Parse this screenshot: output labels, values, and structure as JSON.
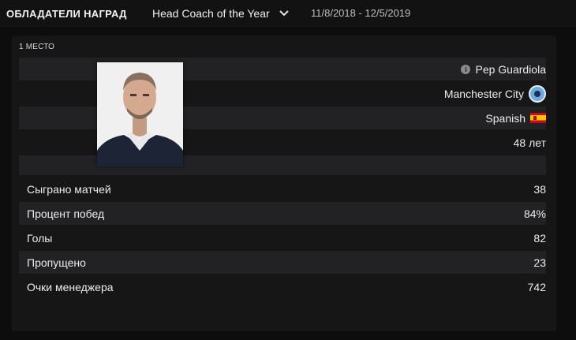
{
  "header": {
    "title": "ОБЛАДАТЕЛИ НАГРАД",
    "award_selector": "Head Coach of the Year",
    "date_range": "11/8/2018 - 12/5/2019"
  },
  "winner": {
    "place": "1 МЕСТО",
    "name": "Pep Guardiola",
    "club": "Manchester City",
    "nationality": "Spanish",
    "age": "48 лет"
  },
  "stats": [
    {
      "label": "Сыграно матчей",
      "value": "38"
    },
    {
      "label": "Процент побед",
      "value": "84%"
    },
    {
      "label": "Голы",
      "value": "82"
    },
    {
      "label": "Пропущено",
      "value": "23"
    },
    {
      "label": "Очки менеджера",
      "value": "742"
    }
  ],
  "icons": {
    "info": "info-icon",
    "club_badge": "manchester-city-badge-icon",
    "flag": "spain-flag-icon",
    "dropdown": "chevron-down-icon"
  },
  "colors": {
    "background": "#0d0d0e",
    "panel": "#161617",
    "row_dark": "#222224",
    "text": "#ececec"
  }
}
